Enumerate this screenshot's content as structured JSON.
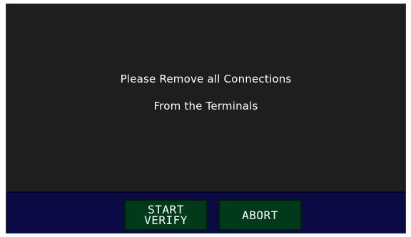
{
  "message": {
    "line1": "Please Remove all Connections",
    "line2": "From the Terminals"
  },
  "buttons": {
    "start_verify": {
      "line1": "START",
      "line2": "VERIFY"
    },
    "abort": {
      "label": "ABORT"
    }
  },
  "colors": {
    "screen_background": "#1e1e1e",
    "button_bar": "#0a0a45",
    "button_fill": "#003a1a",
    "text": "#ffffff"
  }
}
